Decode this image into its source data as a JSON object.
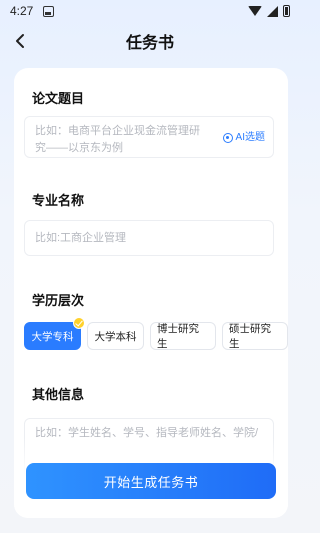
{
  "status": {
    "time": "4:27"
  },
  "header": {
    "title": "任务书"
  },
  "sections": {
    "thesis_title": {
      "label": "论文题目",
      "placeholder": "比如：电商平台企业现金流管理研究——以京东为例",
      "ai_button": "AI选题"
    },
    "major": {
      "label": "专业名称",
      "placeholder": "比如:工商企业管理"
    },
    "education": {
      "label": "学历层次",
      "options": [
        "大学专科",
        "大学本科",
        "博士研究生",
        "硕士研究生"
      ],
      "selected": "大学专科"
    },
    "other": {
      "label": "其他信息",
      "placeholder": "比如：学生姓名、学号、指导老师姓名、学院/"
    }
  },
  "actions": {
    "start_label": "开始生成任务书"
  },
  "colors": {
    "accent": "#2a7cff",
    "check_badge": "#ffd12b"
  }
}
